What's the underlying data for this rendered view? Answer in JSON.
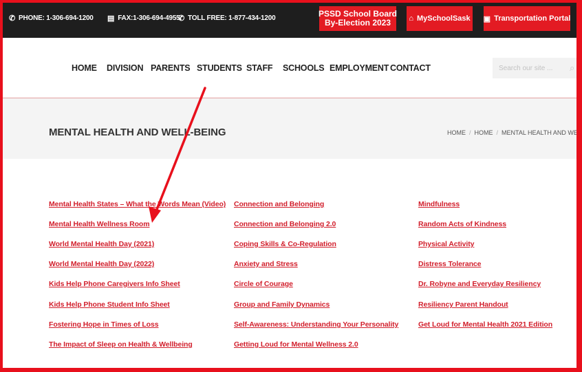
{
  "topbar": {
    "phone": "PHONE: 1-306-694-1200",
    "fax": "FAX:1-306-694-4955",
    "tollfree": "TOLL FREE: 1-877-434-1200",
    "election_line1": "PSSD School Board",
    "election_line2": "By-Election 2023",
    "myschoolsask": "MySchoolSask",
    "transportation": "Transportation Portal"
  },
  "nav": [
    "HOME",
    "DIVISION",
    "PARENTS",
    "STUDENTS",
    "STAFF",
    "SCHOOLS",
    "EMPLOYMENT",
    "CONTACT"
  ],
  "search": {
    "placeholder": "Search our site ..."
  },
  "hero": {
    "title": "MENTAL HEALTH AND WELL-BEING",
    "breadcrumbs": [
      "HOME",
      "HOME",
      "MENTAL HEALTH AND WELL-BEIN"
    ]
  },
  "links": {
    "col1": [
      "Mental Health States – What the Words Mean (Video)",
      "Mental Health Wellness Room",
      "World Mental Health Day (2021)",
      "World Mental Health Day (2022)",
      "Kids Help Phone Caregivers Info Sheet",
      "Kids Help Phone Student Info Sheet",
      "Fostering Hope in Times of Loss",
      "The Impact of Sleep on Health & Wellbeing"
    ],
    "col2": [
      "Connection and Belonging",
      "Connection and Belonging 2.0",
      "Coping Skills & Co-Regulation",
      "Anxiety and Stress",
      "Circle of Courage",
      "Group and Family Dynamics",
      "Self-Awareness: Understanding Your Personality",
      "Getting Loud for Mental Wellness 2.0"
    ],
    "col3": [
      "Mindfulness",
      "Random Acts of Kindness",
      "Physical Activity",
      "Distress Tolerance",
      "Dr. Robyne and Everyday Resiliency",
      "Resiliency Parent Handout",
      "Get Loud for Mental Health 2021 Edition"
    ]
  },
  "colors": {
    "accent": "#e31b23",
    "link": "#d21f2c",
    "topbar": "#1e1e1e"
  },
  "icons": [
    "phone-icon",
    "fax-icon",
    "phone-icon",
    "home-icon",
    "bus-icon",
    "search-icon"
  ]
}
